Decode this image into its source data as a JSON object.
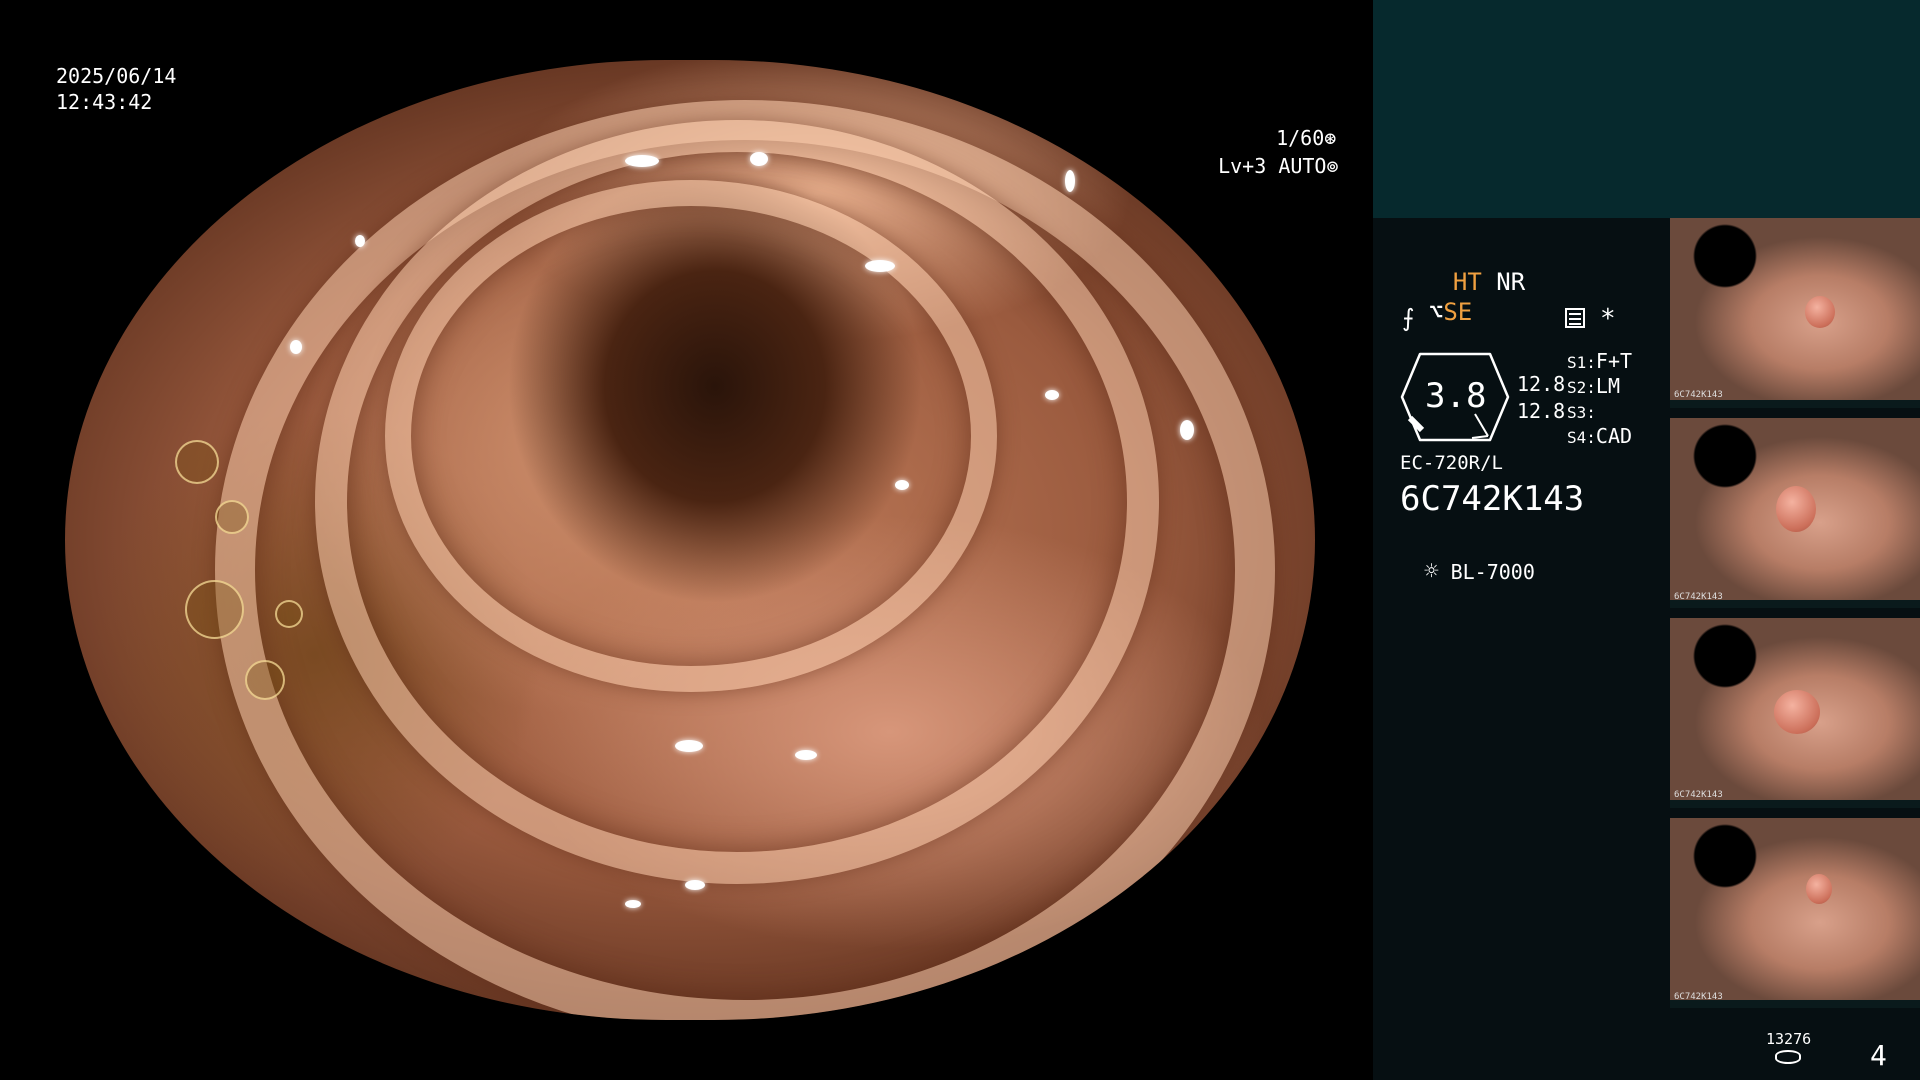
{
  "osd": {
    "date": "2025/06/14",
    "time": "12:43:42",
    "shutter": "1/60",
    "level": "Lv+3",
    "mode": "AUTO"
  },
  "panel": {
    "ht": "HT",
    "nr": "NR",
    "se": "SE",
    "star": "*",
    "ratio_value": "3.8",
    "ratio_a": "12.8",
    "ratio_b": "12.8",
    "s1_label": "S1:",
    "s1_value": "F+T",
    "s2_label": "S2:",
    "s2_value": "LM",
    "s3_label": "S3:",
    "s3_value": "",
    "s4_label": "S4:",
    "s4_value": "CAD",
    "scope_model": "EC-720R/L",
    "serial": "6C742K143",
    "light_source": "BL-7000",
    "counter": "13276",
    "page": "4"
  },
  "thumbnails": [
    {
      "caption": "6C742K143"
    },
    {
      "caption": "6C742K143"
    },
    {
      "caption": "6C742K143"
    },
    {
      "caption": "6C742K143"
    }
  ],
  "colors": {
    "accent_orange": "#f0a040",
    "panel_top": "#06292d",
    "panel_bg": "#060f12"
  }
}
